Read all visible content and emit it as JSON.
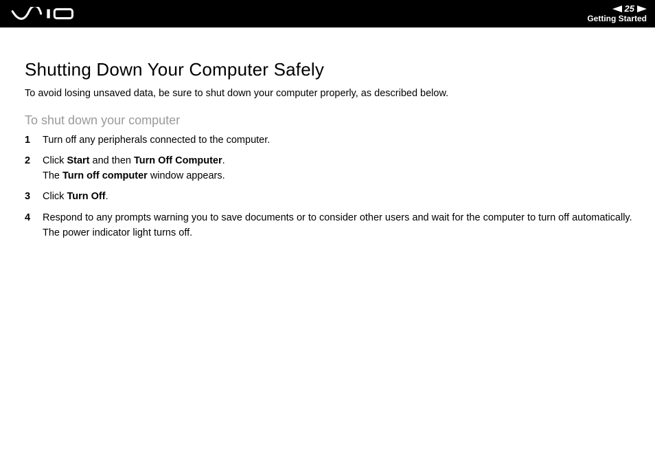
{
  "header": {
    "logo_name": "vaio-logo",
    "page_number": "25",
    "section": "Getting Started"
  },
  "body": {
    "title": "Shutting Down Your Computer Safely",
    "intro": "To avoid losing unsaved data, be sure to shut down your computer properly, as described below.",
    "subhead": "To shut down your computer",
    "steps": [
      {
        "num": "1",
        "lines": [
          {
            "parts": [
              {
                "t": "Turn off any peripherals connected to the computer."
              }
            ]
          }
        ]
      },
      {
        "num": "2",
        "lines": [
          {
            "parts": [
              {
                "t": "Click "
              },
              {
                "t": "Start",
                "b": true
              },
              {
                "t": " and then "
              },
              {
                "t": "Turn Off Computer",
                "b": true
              },
              {
                "t": "."
              }
            ]
          },
          {
            "parts": [
              {
                "t": "The "
              },
              {
                "t": "Turn off computer",
                "b": true
              },
              {
                "t": " window appears."
              }
            ]
          }
        ]
      },
      {
        "num": "3",
        "lines": [
          {
            "parts": [
              {
                "t": "Click "
              },
              {
                "t": "Turn Off",
                "b": true
              },
              {
                "t": "."
              }
            ]
          }
        ]
      },
      {
        "num": "4",
        "lines": [
          {
            "parts": [
              {
                "t": "Respond to any prompts warning you to save documents or to consider other users and wait for the computer to turn off automatically."
              }
            ]
          },
          {
            "gap": true,
            "parts": [
              {
                "t": "The power indicator light turns off."
              }
            ]
          }
        ]
      }
    ]
  }
}
